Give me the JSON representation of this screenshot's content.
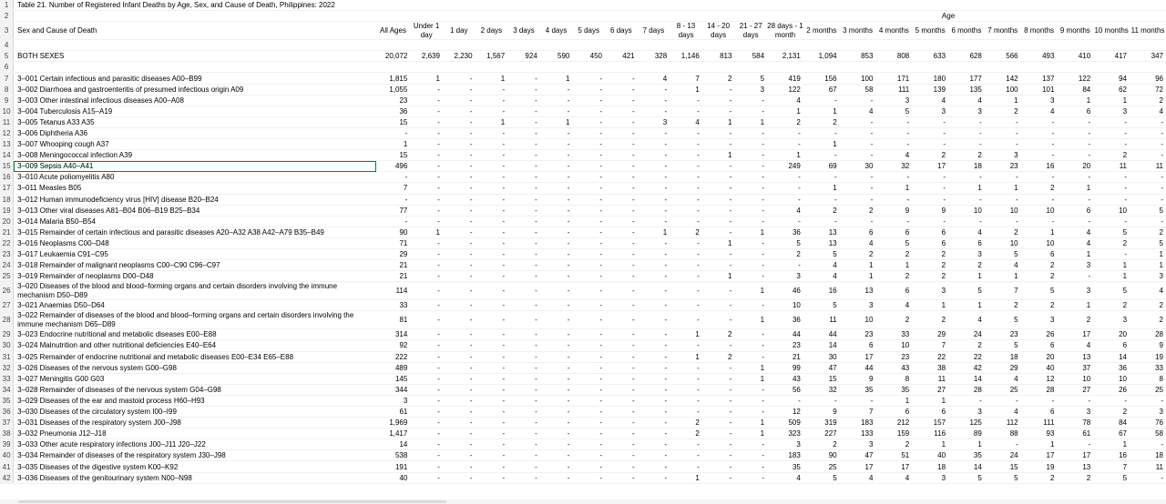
{
  "title": "Table 21.  Number of Registered Infant Deaths by Age, Sex, and Cause of Death, Philippines: 2022",
  "header": {
    "label": "Sex and Cause of Death",
    "age_group": "Age",
    "columns": [
      "All Ages",
      "Under 1 day",
      "1 day",
      "2 days",
      "3 days",
      "4 days",
      "5 days",
      "6 days",
      "7 days",
      "8 - 13 days",
      "14 - 20 days",
      "21 - 27 days",
      "28 days - 1 month",
      "2 months",
      "3 months",
      "4 months",
      "5 months",
      "6 months",
      "7 months",
      "8 months",
      "9 months",
      "10 months",
      "11 months"
    ]
  },
  "rows": [
    {
      "n": "1",
      "type": "title"
    },
    {
      "n": "2",
      "type": "blank"
    },
    {
      "n": "3",
      "type": "header"
    },
    {
      "n": "4",
      "type": "blank"
    },
    {
      "n": "5",
      "label": "BOTH SEXES",
      "ind": 0,
      "v": [
        "20,072",
        "2,639",
        "2,230",
        "1,567",
        "924",
        "590",
        "450",
        "421",
        "328",
        "1,146",
        "813",
        "584",
        "2,131",
        "1,094",
        "853",
        "808",
        "633",
        "628",
        "566",
        "493",
        "410",
        "417",
        "347"
      ]
    },
    {
      "n": "6",
      "type": "blank"
    },
    {
      "n": "7",
      "label": "3–001 Certain infectious and parasitic diseases A00–B99",
      "ind": 0,
      "v": [
        "1,815",
        "1",
        "-",
        "1",
        "-",
        "1",
        "-",
        "-",
        "4",
        "7",
        "2",
        "5",
        "419",
        "156",
        "100",
        "171",
        "180",
        "177",
        "142",
        "137",
        "122",
        "94",
        "96"
      ]
    },
    {
      "n": "8",
      "label": "3–002 Diarrhoea and gastroenteritis of presumed infectious origin A09",
      "ind": 1,
      "v": [
        "1,055",
        "-",
        "-",
        "-",
        "-",
        "-",
        "-",
        "-",
        "-",
        "1",
        "-",
        "3",
        "122",
        "67",
        "58",
        "111",
        "139",
        "135",
        "100",
        "101",
        "84",
        "62",
        "72"
      ]
    },
    {
      "n": "9",
      "label": "3–003 Other intestinal infectious diseases A00–A08",
      "ind": 1,
      "v": [
        "23",
        "-",
        "-",
        "-",
        "-",
        "-",
        "-",
        "-",
        "-",
        "-",
        "-",
        "-",
        "4",
        "-",
        "-",
        "3",
        "4",
        "4",
        "1",
        "3",
        "1",
        "1",
        "2"
      ]
    },
    {
      "n": "10",
      "label": "3–004 Tuberculosis A15–A19",
      "ind": 1,
      "v": [
        "36",
        "-",
        "-",
        "-",
        "-",
        "-",
        "-",
        "-",
        "-",
        "-",
        "-",
        "-",
        "1",
        "1",
        "4",
        "5",
        "3",
        "3",
        "2",
        "4",
        "6",
        "3",
        "4"
      ]
    },
    {
      "n": "11",
      "label": "3–005 Tetanus A33 A35",
      "ind": 1,
      "v": [
        "15",
        "-",
        "-",
        "1",
        "-",
        "1",
        "-",
        "-",
        "3",
        "4",
        "1",
        "1",
        "2",
        "2",
        "-",
        "-",
        "-",
        "-",
        "-",
        "-",
        "-",
        "-",
        "-"
      ]
    },
    {
      "n": "12",
      "label": "3–006 Diphtheria A36",
      "ind": 1,
      "v": [
        "-",
        "-",
        "-",
        "-",
        "-",
        "-",
        "-",
        "-",
        "-",
        "-",
        "-",
        "-",
        "-",
        "-",
        "-",
        "-",
        "-",
        "-",
        "-",
        "-",
        "-",
        "-",
        "-"
      ]
    },
    {
      "n": "13",
      "label": "3–007 Whooping cough A37",
      "ind": 1,
      "v": [
        "1",
        "-",
        "-",
        "-",
        "-",
        "-",
        "-",
        "-",
        "-",
        "-",
        "-",
        "-",
        "-",
        "1",
        "-",
        "-",
        "-",
        "-",
        "-",
        "-",
        "-",
        "-",
        "-"
      ]
    },
    {
      "n": "14",
      "label": "3–008 Meningococcal infection A39",
      "ind": 1,
      "v": [
        "15",
        "-",
        "-",
        "-",
        "-",
        "-",
        "-",
        "-",
        "-",
        "-",
        "1",
        "-",
        "1",
        "-",
        "-",
        "4",
        "2",
        "2",
        "3",
        "-",
        "-",
        "2",
        "-"
      ]
    },
    {
      "n": "15",
      "label": "3–009 Sepsis A40–A41",
      "ind": 1,
      "sel": true,
      "v": [
        "496",
        "-",
        "-",
        "-",
        "-",
        "-",
        "-",
        "-",
        "-",
        "-",
        "-",
        "-",
        "249",
        "69",
        "30",
        "32",
        "17",
        "18",
        "23",
        "16",
        "20",
        "11",
        "11"
      ]
    },
    {
      "n": "16",
      "label": "3–010 Acute poliomyelitis A80",
      "ind": 1,
      "v": [
        "-",
        "-",
        "-",
        "-",
        "-",
        "-",
        "-",
        "-",
        "-",
        "-",
        "-",
        "-",
        "-",
        "-",
        "-",
        "-",
        "-",
        "-",
        "-",
        "-",
        "-",
        "-",
        "-"
      ]
    },
    {
      "n": "17",
      "label": "3–011 Measles B05",
      "ind": 1,
      "v": [
        "7",
        "-",
        "-",
        "-",
        "-",
        "-",
        "-",
        "-",
        "-",
        "-",
        "-",
        "-",
        "-",
        "1",
        "-",
        "1",
        "-",
        "1",
        "1",
        "2",
        "1",
        "-",
        "-"
      ]
    },
    {
      "n": "18",
      "label": "3–012 Human immunodeficiency virus [HIV] disease B20–B24",
      "ind": 1,
      "v": [
        "-",
        "-",
        "-",
        "-",
        "-",
        "-",
        "-",
        "-",
        "-",
        "-",
        "-",
        "-",
        "-",
        "-",
        "-",
        "-",
        "-",
        "-",
        "-",
        "-",
        "-",
        "-",
        "-"
      ]
    },
    {
      "n": "19",
      "label": "3–013 Other viral diseases A81–B04 B06–B19 B25–B34",
      "ind": 1,
      "v": [
        "77",
        "-",
        "-",
        "-",
        "-",
        "-",
        "-",
        "-",
        "-",
        "-",
        "-",
        "-",
        "4",
        "2",
        "2",
        "9",
        "9",
        "10",
        "10",
        "10",
        "6",
        "10",
        "5"
      ]
    },
    {
      "n": "20",
      "label": "3–014 Malaria B50–B54",
      "ind": 1,
      "v": [
        "-",
        "-",
        "-",
        "-",
        "-",
        "-",
        "-",
        "-",
        "-",
        "-",
        "-",
        "-",
        "-",
        "-",
        "-",
        "-",
        "-",
        "-",
        "-",
        "-",
        "-",
        "-",
        "-"
      ]
    },
    {
      "n": "21",
      "label": "3–015 Remainder of certain infectious and parasitic diseases A20–A32 A38 A42–A79 B35–B49",
      "ind": 1,
      "v": [
        "90",
        "1",
        "-",
        "-",
        "-",
        "-",
        "-",
        "-",
        "1",
        "2",
        "-",
        "1",
        "36",
        "13",
        "6",
        "6",
        "6",
        "4",
        "2",
        "1",
        "4",
        "5",
        "2"
      ]
    },
    {
      "n": "22",
      "label": "3–016 Neoplasms C00–D48",
      "ind": 0,
      "v": [
        "71",
        "-",
        "-",
        "-",
        "-",
        "-",
        "-",
        "-",
        "-",
        "-",
        "1",
        "-",
        "5",
        "13",
        "4",
        "5",
        "6",
        "6",
        "10",
        "10",
        "4",
        "2",
        "5"
      ]
    },
    {
      "n": "23",
      "label": "3–017 Leukaemia C91–C95",
      "ind": 1,
      "v": [
        "29",
        "-",
        "-",
        "-",
        "-",
        "-",
        "-",
        "-",
        "-",
        "-",
        "-",
        "-",
        "2",
        "5",
        "2",
        "2",
        "2",
        "3",
        "5",
        "6",
        "1",
        "-",
        "1"
      ]
    },
    {
      "n": "24",
      "label": "3–018 Remainder of malignant neoplasms C00–C90 C96–C97",
      "ind": 1,
      "v": [
        "21",
        "-",
        "-",
        "-",
        "-",
        "-",
        "-",
        "-",
        "-",
        "-",
        "-",
        "-",
        "-",
        "4",
        "1",
        "1",
        "2",
        "2",
        "4",
        "2",
        "3",
        "1",
        "1"
      ]
    },
    {
      "n": "25",
      "label": "3–019 Remainder of neoplasms D00–D48",
      "ind": 1,
      "v": [
        "21",
        "-",
        "-",
        "-",
        "-",
        "-",
        "-",
        "-",
        "-",
        "-",
        "1",
        "-",
        "3",
        "4",
        "1",
        "2",
        "2",
        "1",
        "1",
        "2",
        "-",
        "1",
        "3"
      ]
    },
    {
      "n": "26",
      "label": "3–020 Diseases of the blood and blood–forming organs and certain disorders involving the immune mechanism D50–D89",
      "ind": 0,
      "wrap": true,
      "v": [
        "114",
        "-",
        "-",
        "-",
        "-",
        "-",
        "-",
        "-",
        "-",
        "-",
        "-",
        "1",
        "46",
        "16",
        "13",
        "6",
        "3",
        "5",
        "7",
        "5",
        "3",
        "5",
        "4"
      ]
    },
    {
      "n": "27",
      "label": "3–021 Anaemias D50–D64",
      "ind": 1,
      "v": [
        "33",
        "-",
        "-",
        "-",
        "-",
        "-",
        "-",
        "-",
        "-",
        "-",
        "-",
        "-",
        "10",
        "5",
        "3",
        "4",
        "1",
        "1",
        "2",
        "2",
        "1",
        "2",
        "2"
      ]
    },
    {
      "n": "28",
      "label": "3–022 Remainder of diseases of the blood and blood–forming organs and certain disorders involving the immune mechanism D65–D89",
      "ind": 1,
      "wrap": true,
      "v": [
        "81",
        "-",
        "-",
        "-",
        "-",
        "-",
        "-",
        "-",
        "-",
        "-",
        "-",
        "1",
        "36",
        "11",
        "10",
        "2",
        "2",
        "4",
        "5",
        "3",
        "2",
        "3",
        "2"
      ]
    },
    {
      "n": "29",
      "label": "3–023 Endocrine nutritional and metabolic diseases E00–E88",
      "ind": 0,
      "v": [
        "314",
        "-",
        "-",
        "-",
        "-",
        "-",
        "-",
        "-",
        "-",
        "1",
        "2",
        "-",
        "44",
        "44",
        "23",
        "33",
        "29",
        "24",
        "23",
        "26",
        "17",
        "20",
        "28"
      ]
    },
    {
      "n": "30",
      "label": "3–024 Malnutrition and other nutritional deficiencies E40–E64",
      "ind": 1,
      "v": [
        "92",
        "-",
        "-",
        "-",
        "-",
        "-",
        "-",
        "-",
        "-",
        "-",
        "-",
        "-",
        "23",
        "14",
        "6",
        "10",
        "7",
        "2",
        "5",
        "6",
        "4",
        "6",
        "9"
      ]
    },
    {
      "n": "31",
      "label": "3–025 Remainder of endocrine nutritional and metabolic diseases E00–E34 E65–E88",
      "ind": 1,
      "v": [
        "222",
        "-",
        "-",
        "-",
        "-",
        "-",
        "-",
        "-",
        "-",
        "1",
        "2",
        "-",
        "21",
        "30",
        "17",
        "23",
        "22",
        "22",
        "18",
        "20",
        "13",
        "14",
        "19"
      ]
    },
    {
      "n": "32",
      "label": "3–026 Diseases of the nervous system G00–G98",
      "ind": 0,
      "v": [
        "489",
        "-",
        "-",
        "-",
        "-",
        "-",
        "-",
        "-",
        "-",
        "-",
        "-",
        "1",
        "99",
        "47",
        "44",
        "43",
        "38",
        "42",
        "29",
        "40",
        "37",
        "36",
        "33"
      ]
    },
    {
      "n": "33",
      "label": "3–027 Meningitis G00 G03",
      "ind": 1,
      "v": [
        "145",
        "-",
        "-",
        "-",
        "-",
        "-",
        "-",
        "-",
        "-",
        "-",
        "-",
        "1",
        "43",
        "15",
        "9",
        "8",
        "11",
        "14",
        "4",
        "12",
        "10",
        "10",
        "8"
      ]
    },
    {
      "n": "34",
      "label": "3–028 Remainder of diseases of the nervous system G04–G98",
      "ind": 1,
      "v": [
        "344",
        "-",
        "-",
        "-",
        "-",
        "-",
        "-",
        "-",
        "-",
        "-",
        "-",
        "-",
        "56",
        "32",
        "35",
        "35",
        "27",
        "28",
        "25",
        "28",
        "27",
        "26",
        "25"
      ]
    },
    {
      "n": "35",
      "label": "3–029 Diseases of the ear and mastoid process H60–H93",
      "ind": 0,
      "v": [
        "3",
        "-",
        "-",
        "-",
        "-",
        "-",
        "-",
        "-",
        "-",
        "-",
        "-",
        "-",
        "-",
        "-",
        "-",
        "1",
        "1",
        "-",
        "-",
        "-",
        "-",
        "-",
        "-"
      ]
    },
    {
      "n": "36",
      "label": "3–030 Diseases of the circulatory system I00–I99",
      "ind": 0,
      "v": [
        "61",
        "-",
        "-",
        "-",
        "-",
        "-",
        "-",
        "-",
        "-",
        "-",
        "-",
        "-",
        "12",
        "9",
        "7",
        "6",
        "6",
        "3",
        "4",
        "6",
        "3",
        "2",
        "3"
      ]
    },
    {
      "n": "37",
      "label": "3–031 Diseases of the respiratory system J00–J98",
      "ind": 0,
      "v": [
        "1,969",
        "-",
        "-",
        "-",
        "-",
        "-",
        "-",
        "-",
        "-",
        "2",
        "-",
        "1",
        "509",
        "319",
        "183",
        "212",
        "157",
        "125",
        "112",
        "111",
        "78",
        "84",
        "76"
      ]
    },
    {
      "n": "38",
      "label": "3–032 Pneumonia J12–J18",
      "ind": 1,
      "v": [
        "1,417",
        "-",
        "-",
        "-",
        "-",
        "-",
        "-",
        "-",
        "-",
        "2",
        "-",
        "1",
        "323",
        "227",
        "133",
        "159",
        "116",
        "89",
        "88",
        "93",
        "61",
        "67",
        "58"
      ]
    },
    {
      "n": "39",
      "label": "3–033 Other acute respiratory infections J00–J11 J20–J22",
      "ind": 1,
      "v": [
        "14",
        "-",
        "-",
        "-",
        "-",
        "-",
        "-",
        "-",
        "-",
        "-",
        "-",
        "-",
        "3",
        "2",
        "3",
        "2",
        "1",
        "1",
        "-",
        "1",
        "-",
        "1",
        "-"
      ]
    },
    {
      "n": "40",
      "label": "3–034 Remainder of diseases of the respiratory system J30–J98",
      "ind": 1,
      "v": [
        "538",
        "-",
        "-",
        "-",
        "-",
        "-",
        "-",
        "-",
        "-",
        "-",
        "-",
        "-",
        "183",
        "90",
        "47",
        "51",
        "40",
        "35",
        "24",
        "17",
        "17",
        "16",
        "18"
      ]
    },
    {
      "n": "41",
      "label": "3–035 Diseases of the digestive system K00–K92",
      "ind": 0,
      "v": [
        "191",
        "-",
        "-",
        "-",
        "-",
        "-",
        "-",
        "-",
        "-",
        "-",
        "-",
        "-",
        "35",
        "25",
        "17",
        "17",
        "18",
        "14",
        "15",
        "19",
        "13",
        "7",
        "11"
      ]
    },
    {
      "n": "42",
      "label": "3–036 Diseases of the genitourinary system N00–N98",
      "ind": 0,
      "v": [
        "40",
        "-",
        "-",
        "-",
        "-",
        "-",
        "-",
        "-",
        "-",
        "1",
        "-",
        "-",
        "4",
        "5",
        "4",
        "4",
        "3",
        "5",
        "5",
        "2",
        "2",
        "5",
        "-"
      ]
    }
  ]
}
